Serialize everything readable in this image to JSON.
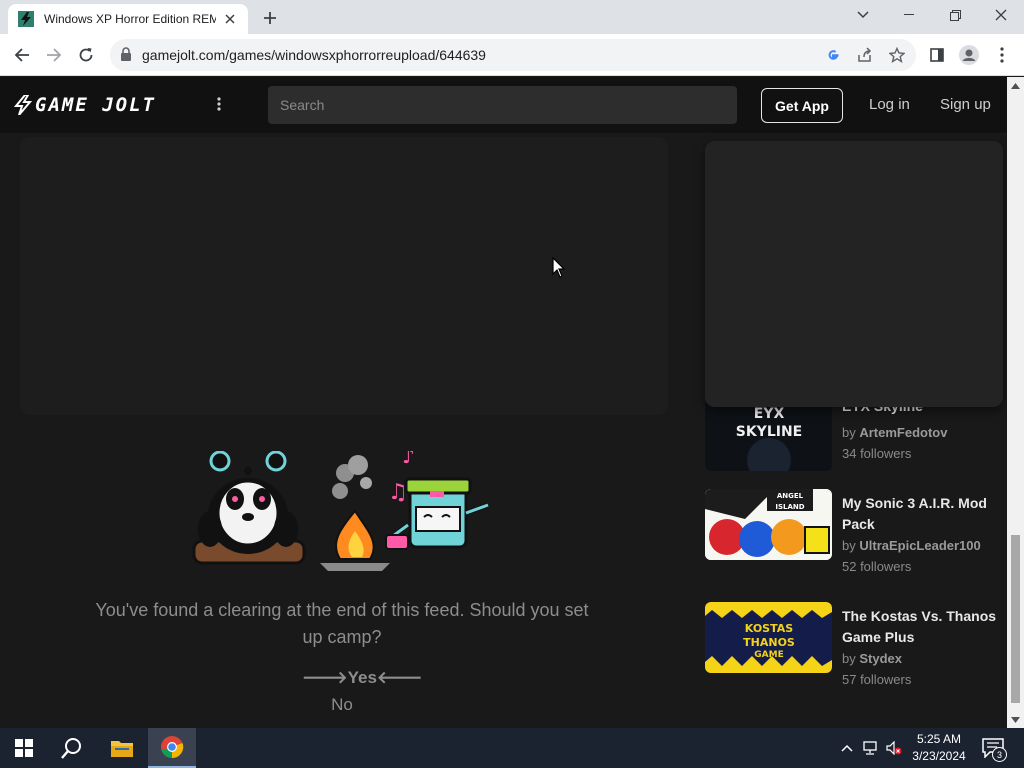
{
  "browser": {
    "tab_title": "Windows XP Horror Edition REMAKE",
    "url": "gamejolt.com/games/windowsxphorrorreupload/644639"
  },
  "site": {
    "logo_text": "GAME JOLT",
    "search_placeholder": "Search",
    "get_app_label": "Get App",
    "login_label": "Log in",
    "signup_label": "Sign up"
  },
  "feed_end": {
    "message": "You've found a clearing at the end of this feed. Should you set up camp?",
    "yes_label": "Yes",
    "no_label": "No"
  },
  "recommended_games": [
    {
      "title": "EYX Skyline",
      "by_prefix": "by",
      "author": "ArtemFedotov",
      "followers": "34 followers",
      "thumb_text": "EYX SKYLINE"
    },
    {
      "title": "My Sonic 3 A.I.R. Mod Pack",
      "by_prefix": "by",
      "author": "UltraEpicLeader100",
      "followers": "52 followers",
      "thumb_text": "ANGEL ISLAND REVISITED"
    },
    {
      "title": "The Kostas Vs. Thanos Game Plus",
      "by_prefix": "by",
      "author": "Stydex",
      "followers": "57 followers",
      "thumb_text": "THE KOSTAS VS THANOS GAME +"
    }
  ],
  "taskbar": {
    "time": "5:25 AM",
    "date": "3/23/2024",
    "notification_count": "3"
  },
  "colors": {
    "page_bg": "#191919",
    "header_bg": "#111111",
    "accent": "#ccff00"
  }
}
